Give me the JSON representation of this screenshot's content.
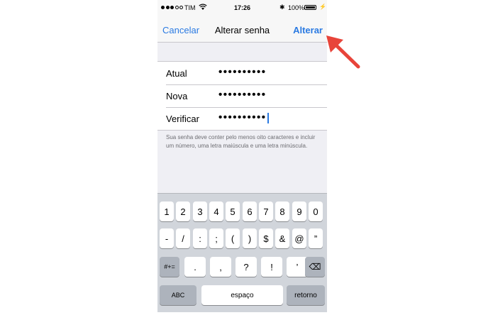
{
  "status_bar": {
    "carrier": "TIM",
    "time": "17:26",
    "battery": "100%",
    "bluetooth_glyph": "✱",
    "charging_glyph": "⚡"
  },
  "nav": {
    "cancel": "Cancelar",
    "title": "Alterar senha",
    "done": "Alterar"
  },
  "fields": [
    {
      "label": "Atual",
      "value": "••••••••••"
    },
    {
      "label": "Nova",
      "value": "••••••••••"
    },
    {
      "label": "Verificar",
      "value": "••••••••••"
    }
  ],
  "hint": "Sua senha deve conter pelo menos oito caracteres e incluir um número, uma letra maiúscula e uma letra minúscula.",
  "keyboard": {
    "row1": [
      "1",
      "2",
      "3",
      "4",
      "5",
      "6",
      "7",
      "8",
      "9",
      "0"
    ],
    "row2": [
      "-",
      "/",
      ":",
      ";",
      "(",
      ")",
      "$",
      "&",
      "@",
      "”"
    ],
    "row3": [
      "#+=",
      ".",
      ",",
      "?",
      "!",
      "’"
    ],
    "row4": [
      "ABC",
      "espaço",
      "retorno"
    ],
    "backspace_glyph": "⌫"
  },
  "colors": {
    "accent": "#2a7ae2",
    "annotation_arrow": "#e8443a"
  }
}
